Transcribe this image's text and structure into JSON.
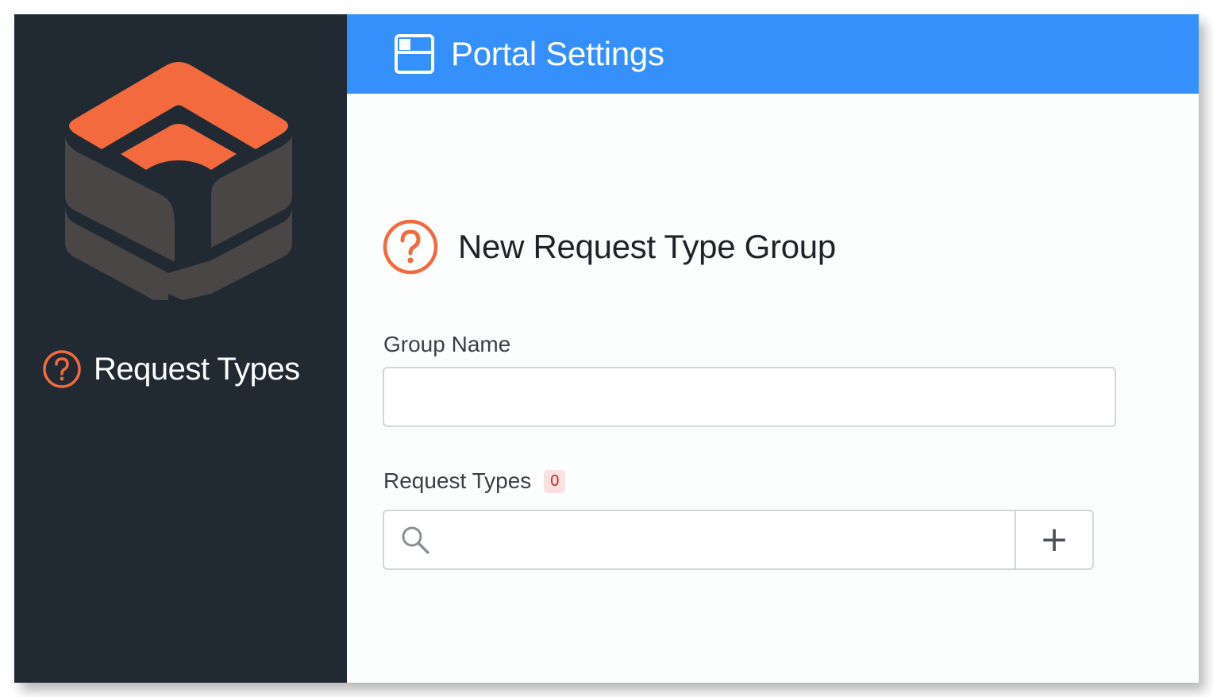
{
  "sidebar": {
    "title": "Request Types",
    "icon": "question-circle-icon",
    "logo": "stacked-cube-logo",
    "accent_color": "#f26a3d",
    "background": "#212a33"
  },
  "topbar": {
    "title": "Portal Settings",
    "icon": "panel-layout-icon",
    "background": "#3590fc"
  },
  "form": {
    "heading": "New Request Type Group",
    "heading_icon": "question-circle-icon",
    "group_name": {
      "label": "Group Name",
      "value": ""
    },
    "request_types": {
      "label": "Request Types",
      "count": "0",
      "search_value": "",
      "search_icon": "search-icon",
      "add_label": "+"
    }
  }
}
